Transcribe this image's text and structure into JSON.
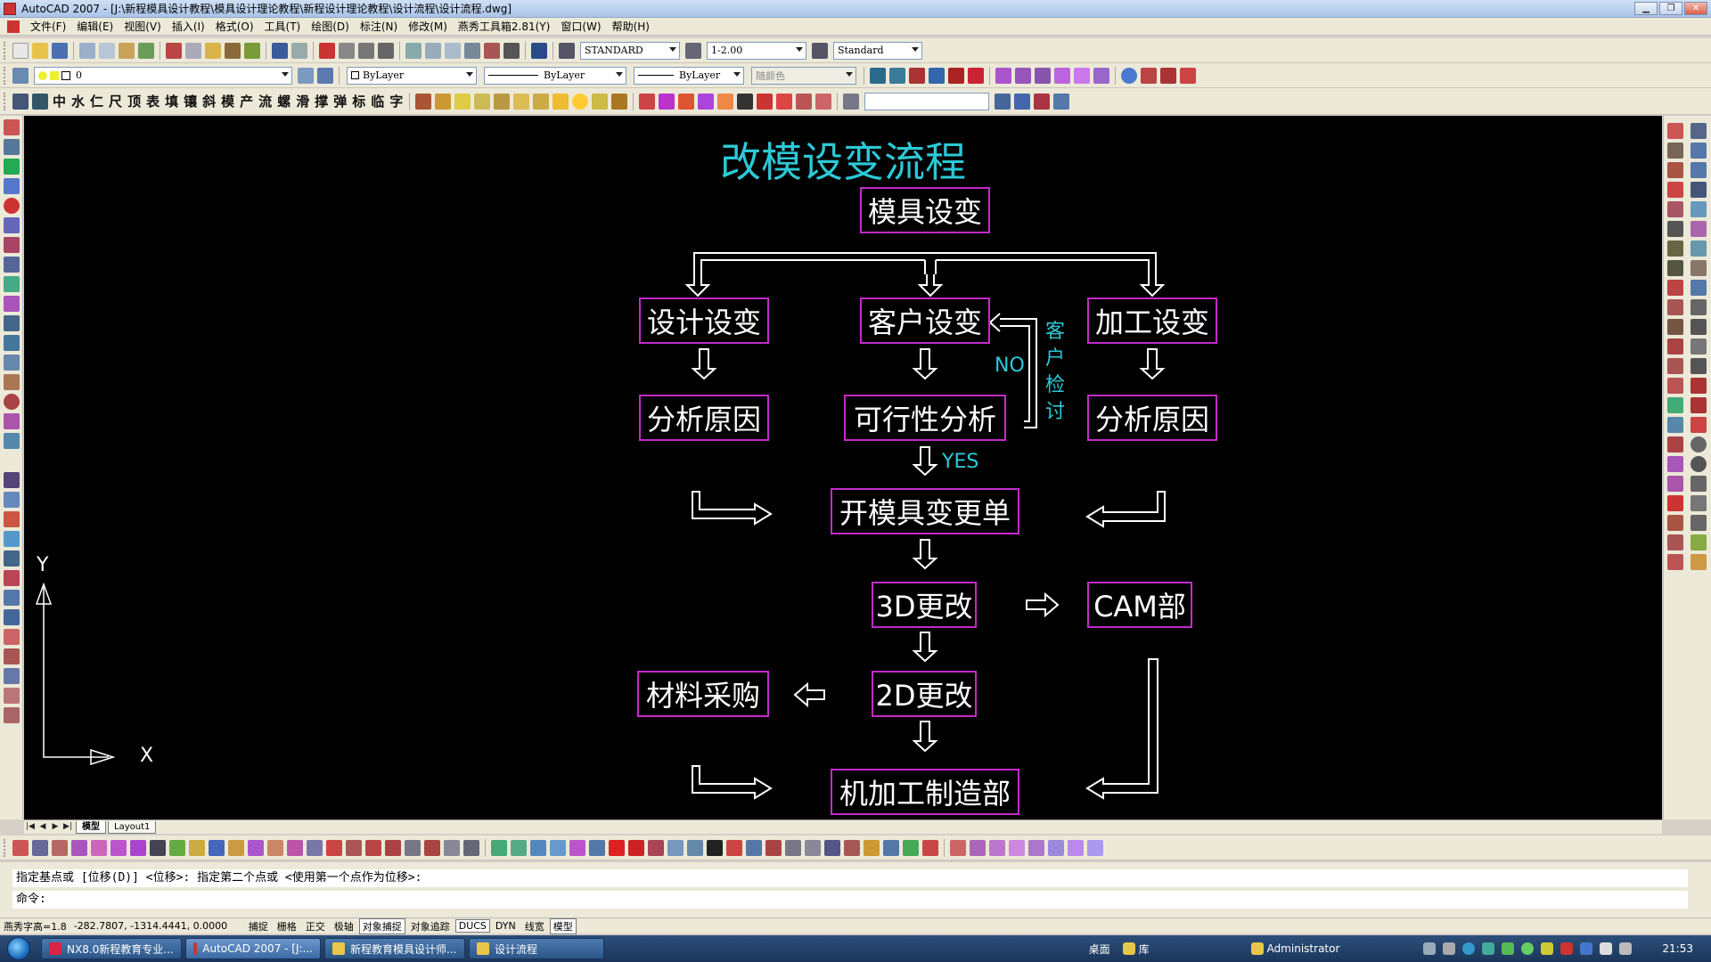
{
  "window": {
    "title": "AutoCAD 2007 - [J:\\新程模具设计教程\\模具设计理论教程\\新程设计理论教程\\设计流程\\设计流程.dwg]",
    "buttons": [
      "▁",
      "❐",
      "✕"
    ]
  },
  "menu": {
    "items": [
      "文件(F)",
      "编辑(E)",
      "视图(V)",
      "插入(I)",
      "格式(O)",
      "工具(T)",
      "绘图(D)",
      "标注(N)",
      "修改(M)",
      "燕秀工具箱2.81(Y)",
      "窗口(W)",
      "帮助(H)"
    ],
    "mdi_buttons": [
      "▁",
      "❐",
      "✕"
    ]
  },
  "toolbar1": {
    "text_style": "STANDARD",
    "dim_style": "1-2.00",
    "table_style": "Standard"
  },
  "toolbar2": {
    "layer": "0",
    "color": "ByLayer",
    "linetype": "ByLayer",
    "lineweight": "ByLayer",
    "plot_style": "随颜色"
  },
  "toolbar3": {
    "chars": [
      "中",
      "水",
      "仁",
      "尺",
      "顶",
      "表",
      "填",
      "镶",
      "斜",
      "模",
      "产",
      "流",
      "螺",
      "滑",
      "撑",
      "弹",
      "标",
      "临",
      "字"
    ]
  },
  "drawing": {
    "title": "改模设变流程",
    "boxes": {
      "mold_change": "模具设变",
      "design_change": "设计设变",
      "customer_change": "客户设变",
      "machining_change": "加工设变",
      "analyze_left": "分析原因",
      "feasibility": "可行性分析",
      "analyze_right": "分析原因",
      "change_order": "开模具变更单",
      "change_3d": "3D更改",
      "cam": "CAM部",
      "purchase": "材料采购",
      "change_2d": "2D更改",
      "machining": "机加工制造部"
    },
    "labels": {
      "no": "NO",
      "yes": "YES",
      "customer_review": [
        "客",
        "户",
        "检",
        "讨"
      ]
    },
    "ucs": {
      "x": "X",
      "y": "Y"
    }
  },
  "layout_tabs": {
    "nav": [
      "|◀",
      "◀",
      "▶",
      "▶|"
    ],
    "tabs": [
      "模型",
      "Layout1"
    ]
  },
  "command": {
    "history": "指定基点或 [位移(D)] <位移>:  指定第二个点或 <使用第一个点作为位移>:",
    "prompt": "命令:"
  },
  "status": {
    "font_height": "燕秀字高=1.8",
    "coordinates": "-282.7807, -1314.4441, 0.0000",
    "toggles": [
      "捕捉",
      "栅格",
      "正交",
      "极轴",
      "对象捕捉",
      "对象追踪",
      "DUCS",
      "DYN",
      "线宽",
      "模型"
    ],
    "toggles_on": [
      false,
      false,
      false,
      false,
      true,
      false,
      true,
      false,
      false,
      true
    ]
  },
  "taskbar": {
    "tasks": [
      "NX8.0新程教育专业...",
      "AutoCAD 2007 - [J:...",
      "新程教育模具设计师...",
      "设计流程"
    ],
    "desktop": "桌面",
    "library": "库",
    "user": "Administrator",
    "time": "21:53"
  },
  "colors": {
    "canvas_bg": "#000000",
    "box_border": "#c22bc8",
    "title_cyan": "#2cc9d6",
    "wire": "#ffffff"
  }
}
